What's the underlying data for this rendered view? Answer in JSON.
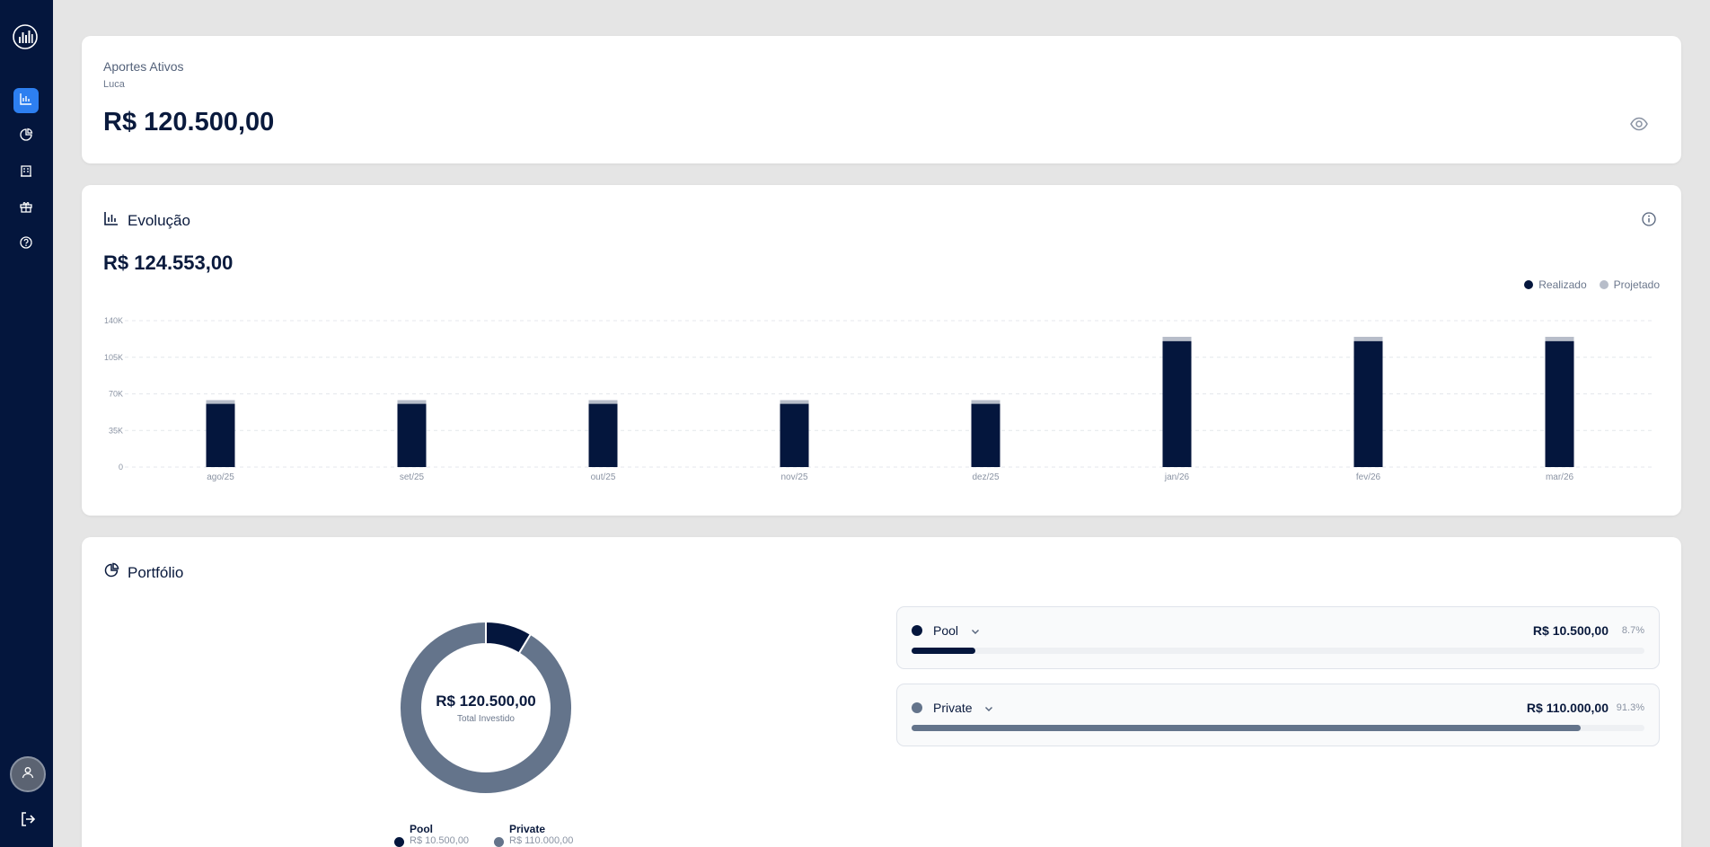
{
  "sidebar": {
    "items": [
      {
        "name": "evolucao",
        "icon": "bar-chart-icon",
        "active": true
      },
      {
        "name": "portfolio",
        "icon": "pie-chart-icon",
        "active": false
      },
      {
        "name": "documents",
        "icon": "building-icon",
        "active": false
      },
      {
        "name": "gifts",
        "icon": "gift-icon",
        "active": false
      },
      {
        "name": "help",
        "icon": "help-circle-icon",
        "active": false
      }
    ]
  },
  "aportes": {
    "title": "Aportes Ativos",
    "subtitle": "Luca",
    "amount": "R$ 120.500,00"
  },
  "evolucao": {
    "title": "Evolução",
    "amount": "R$ 124.553,00",
    "legend": [
      {
        "label": "Realizado",
        "color": "#04163d"
      },
      {
        "label": "Projetado",
        "color": "#b7bdc9"
      }
    ]
  },
  "chart_data": {
    "type": "bar",
    "stacked": true,
    "categories": [
      "ago/25",
      "set/25",
      "out/25",
      "nov/25",
      "dez/25",
      "jan/26",
      "fev/26",
      "mar/26"
    ],
    "series": [
      {
        "name": "Realizado",
        "color": "#04163d",
        "values": [
          60500,
          60500,
          60500,
          60500,
          60500,
          120500,
          120500,
          120500
        ]
      },
      {
        "name": "Projetado",
        "color": "#b7bdc9",
        "values": [
          3500,
          3500,
          3500,
          3500,
          3500,
          4053,
          4053,
          4053
        ]
      }
    ],
    "yticks": [
      "0",
      "35K",
      "70K",
      "105K",
      "140K"
    ],
    "ylim": [
      0,
      140000
    ],
    "grid": true,
    "legend_position": "top-right"
  },
  "portfolio": {
    "title": "Portfólio",
    "total": "R$ 120.500,00",
    "total_label": "Total Investido",
    "items": [
      {
        "name": "Pool",
        "amount": "R$ 10.500,00",
        "pct": "8.7%",
        "fraction": 0.087,
        "color": "#04163d"
      },
      {
        "name": "Private",
        "amount": "R$ 110.000,00",
        "pct": "91.3%",
        "fraction": 0.913,
        "color": "#64748b"
      }
    ]
  }
}
